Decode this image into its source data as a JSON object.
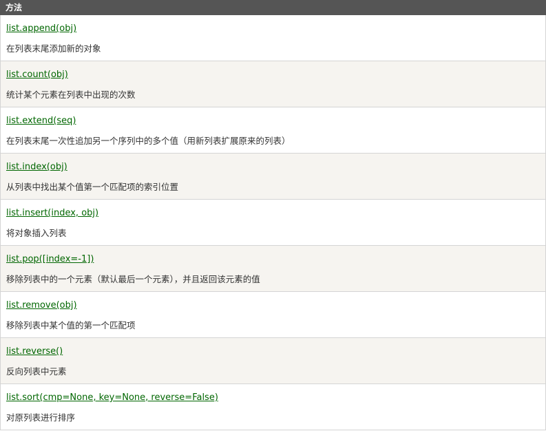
{
  "header": {
    "title": "方法"
  },
  "rows": [
    {
      "method": "list.append(obj)",
      "desc": "在列表末尾添加新的对象"
    },
    {
      "method": "list.count(obj)",
      "desc": "统计某个元素在列表中出现的次数"
    },
    {
      "method": "list.extend(seq)",
      "desc": "在列表末尾一次性追加另一个序列中的多个值（用新列表扩展原来的列表）"
    },
    {
      "method": "list.index(obj)",
      "desc": "从列表中找出某个值第一个匹配项的索引位置"
    },
    {
      "method": "list.insert(index, obj)",
      "desc": "将对象插入列表"
    },
    {
      "method": "list.pop([index=-1])",
      "desc": "移除列表中的一个元素（默认最后一个元素），并且返回该元素的值"
    },
    {
      "method": "list.remove(obj)",
      "desc": "移除列表中某个值的第一个匹配项"
    },
    {
      "method": "list.reverse()",
      "desc": "反向列表中元素"
    },
    {
      "method": "list.sort(cmp=None, key=None, reverse=False)",
      "desc": "对原列表进行排序"
    }
  ]
}
